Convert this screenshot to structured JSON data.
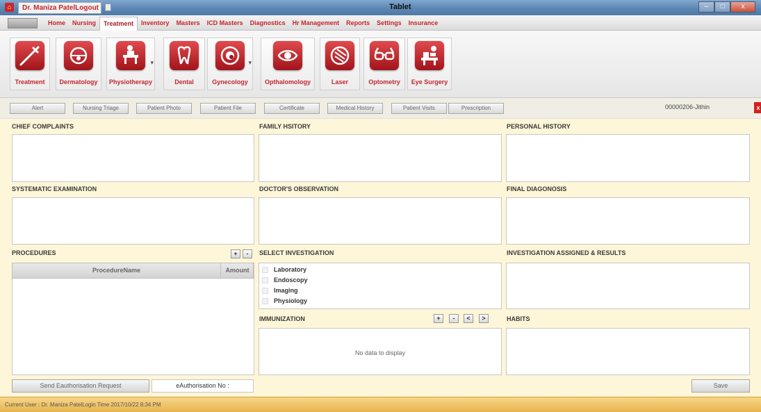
{
  "window": {
    "title": "Tablet",
    "tab_label": "Dr. Maniza PatelLogout",
    "buttons": [
      "–",
      "□",
      "x"
    ]
  },
  "menu": {
    "items": [
      "Home",
      "Nursing",
      "Treatment",
      "Inventory",
      "Masters",
      "ICD Masters",
      "Diagnostics",
      "Hr Management",
      "Reports",
      "Settings",
      "Insurance"
    ],
    "active": "Treatment"
  },
  "ribbon": {
    "tiles": [
      {
        "label": "Treatment",
        "icon": "syringe-icon"
      },
      {
        "label": "Dermatology",
        "icon": "skin-icon"
      },
      {
        "label": "Physiotherapy",
        "icon": "physiotherapy-icon"
      },
      {
        "label": "Dental",
        "icon": "tooth-icon"
      },
      {
        "label": "Gynecology",
        "icon": "gynecology-icon"
      },
      {
        "label": "Opthalomology",
        "icon": "eye-icon"
      },
      {
        "label": "Laser",
        "icon": "laser-icon"
      },
      {
        "label": "Optometry",
        "icon": "glasses-icon"
      },
      {
        "label": "Eye Surgery",
        "icon": "eye-surgery-icon"
      }
    ]
  },
  "nav_buttons": [
    "Alert",
    "Nursing Triage",
    "Patient Photo",
    "Patient File",
    "Certificate",
    "Medical History",
    "Patient Visits",
    "Prescription"
  ],
  "patient_id": "00000206-Jithin",
  "close_label": "x",
  "sections": {
    "chief_complaints": "CHIEF COMPLAINTS",
    "family_history": "FAMILY HSITORY",
    "personal_history": "PERSONAL HISTORY",
    "systematic_examination": "SYSTEMATIC EXAMINATION",
    "doctors_observation": "DOCTOR'S OBSERVATION",
    "final_diagnosis": "FINAL DIAGONOSIS",
    "procedures": "PROCEDURES",
    "select_investigation": "SELECT INVESTIGATION",
    "investigation_assigned": "INVESTIGATION ASSIGNED & RESULTS",
    "immunization": "IMMUNIZATION",
    "habits": "HABITS"
  },
  "procedures_table": {
    "columns": [
      "ProcedureName",
      "Amount"
    ],
    "add": "+",
    "remove": "-"
  },
  "investigations": [
    "Laboratory",
    "Endoscopy",
    "Imaging",
    "Physiology"
  ],
  "immunization": {
    "buttons": [
      "+",
      "-",
      "<",
      ">"
    ],
    "empty_text": "No data to display"
  },
  "footer": {
    "eauth_button": "Send Eauthorisation Request",
    "eauth_field": "eAuthorisation No :",
    "save": "Save"
  },
  "status": "Current User : Dr. Maniza PatelLogin Time 2017/10/22 8:34 PM",
  "colors": {
    "brand_red": "#c3262c",
    "panel_bg": "#fdf6d8",
    "status_bar": "#e7b44c"
  }
}
